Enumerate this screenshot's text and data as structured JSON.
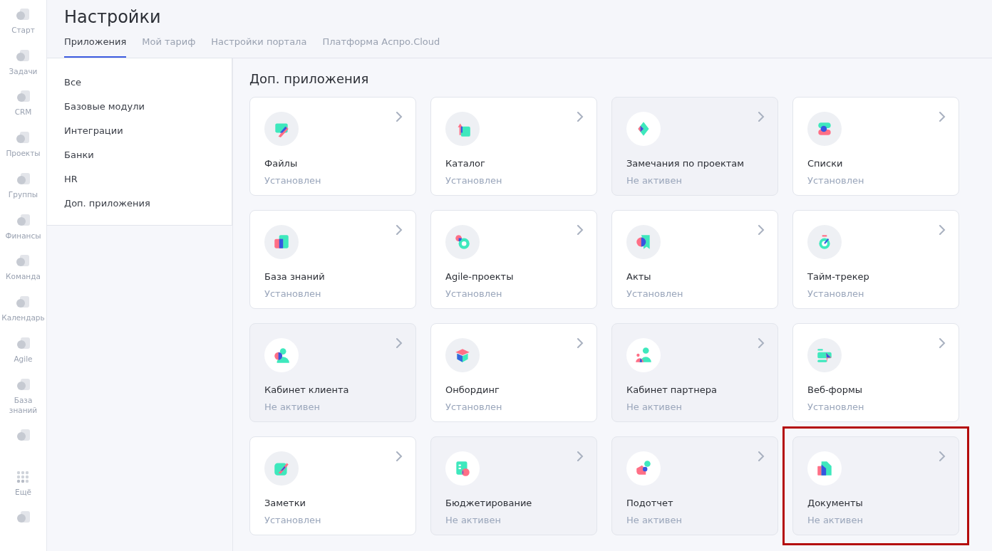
{
  "rail": [
    {
      "kind": "app",
      "label": "Старт"
    },
    {
      "kind": "app",
      "label": "Задачи"
    },
    {
      "kind": "app",
      "label": "CRM"
    },
    {
      "kind": "app",
      "label": "Проекты"
    },
    {
      "kind": "app",
      "label": "Группы"
    },
    {
      "kind": "app",
      "label": "Финансы"
    },
    {
      "kind": "app",
      "label": "Команда"
    },
    {
      "kind": "app",
      "label": "Календарь"
    },
    {
      "kind": "app",
      "label": "Agile"
    },
    {
      "kind": "app",
      "label": "База знаний"
    },
    {
      "kind": "icon"
    },
    {
      "kind": "more",
      "label": "Ещё"
    },
    {
      "kind": "icon"
    }
  ],
  "header": {
    "title": "Настройки",
    "tabs": [
      {
        "label": "Приложения",
        "selected": true
      },
      {
        "label": "Мой тариф",
        "selected": false
      },
      {
        "label": "Настройки портала",
        "selected": false
      },
      {
        "label": "Платформа Аспро.Cloud",
        "selected": false
      }
    ]
  },
  "categories": [
    {
      "label": "Все"
    },
    {
      "label": "Базовые модули"
    },
    {
      "label": "Интеграции"
    },
    {
      "label": "Банки"
    },
    {
      "label": "HR"
    },
    {
      "label": "Доп. приложения"
    }
  ],
  "section_title": "Доп. приложения",
  "apps": [
    {
      "name": "Файлы",
      "status": "Установлен",
      "installed": true,
      "highlighted": false
    },
    {
      "name": "Каталог",
      "status": "Установлен",
      "installed": true,
      "highlighted": false
    },
    {
      "name": "Замечания по проектам",
      "status": "Не активен",
      "installed": false,
      "highlighted": false
    },
    {
      "name": "Списки",
      "status": "Установлен",
      "installed": true,
      "highlighted": false
    },
    {
      "name": "База знаний",
      "status": "Установлен",
      "installed": true,
      "highlighted": false
    },
    {
      "name": "Agile-проекты",
      "status": "Установлен",
      "installed": true,
      "highlighted": false
    },
    {
      "name": "Акты",
      "status": "Установлен",
      "installed": true,
      "highlighted": false
    },
    {
      "name": "Тайм-трекер",
      "status": "Установлен",
      "installed": true,
      "highlighted": false
    },
    {
      "name": "Кабинет клиента",
      "status": "Не активен",
      "installed": false,
      "highlighted": false
    },
    {
      "name": "Онбординг",
      "status": "Установлен",
      "installed": true,
      "highlighted": false
    },
    {
      "name": "Кабинет партнера",
      "status": "Не активен",
      "installed": false,
      "highlighted": false
    },
    {
      "name": "Веб-формы",
      "status": "Установлен",
      "installed": true,
      "highlighted": false
    },
    {
      "name": "Заметки",
      "status": "Установлен",
      "installed": true,
      "highlighted": false
    },
    {
      "name": "Бюджетирование",
      "status": "Не активен",
      "installed": false,
      "highlighted": false
    },
    {
      "name": "Подотчет",
      "status": "Не активен",
      "installed": false,
      "highlighted": false
    },
    {
      "name": "Документы",
      "status": "Не активен",
      "installed": false,
      "highlighted": true
    }
  ]
}
